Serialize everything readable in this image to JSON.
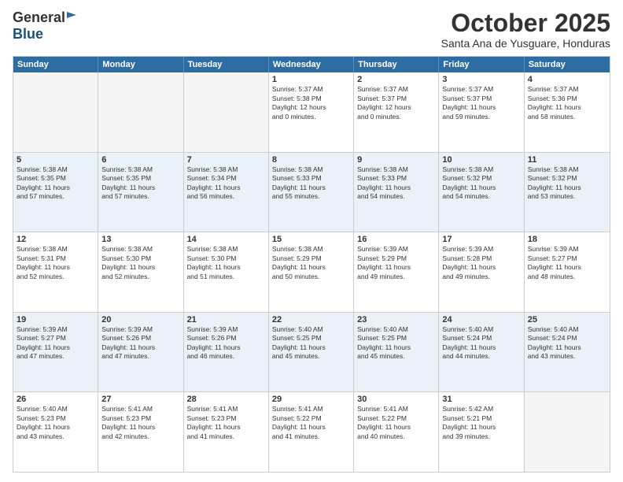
{
  "header": {
    "logo_general": "General",
    "logo_blue": "Blue",
    "month": "October 2025",
    "location": "Santa Ana de Yusguare, Honduras"
  },
  "weekdays": [
    "Sunday",
    "Monday",
    "Tuesday",
    "Wednesday",
    "Thursday",
    "Friday",
    "Saturday"
  ],
  "rows": [
    [
      {
        "day": "",
        "text": ""
      },
      {
        "day": "",
        "text": ""
      },
      {
        "day": "",
        "text": ""
      },
      {
        "day": "1",
        "text": "Sunrise: 5:37 AM\nSunset: 5:38 PM\nDaylight: 12 hours\nand 0 minutes."
      },
      {
        "day": "2",
        "text": "Sunrise: 5:37 AM\nSunset: 5:37 PM\nDaylight: 12 hours\nand 0 minutes."
      },
      {
        "day": "3",
        "text": "Sunrise: 5:37 AM\nSunset: 5:37 PM\nDaylight: 11 hours\nand 59 minutes."
      },
      {
        "day": "4",
        "text": "Sunrise: 5:37 AM\nSunset: 5:36 PM\nDaylight: 11 hours\nand 58 minutes."
      }
    ],
    [
      {
        "day": "5",
        "text": "Sunrise: 5:38 AM\nSunset: 5:35 PM\nDaylight: 11 hours\nand 57 minutes."
      },
      {
        "day": "6",
        "text": "Sunrise: 5:38 AM\nSunset: 5:35 PM\nDaylight: 11 hours\nand 57 minutes."
      },
      {
        "day": "7",
        "text": "Sunrise: 5:38 AM\nSunset: 5:34 PM\nDaylight: 11 hours\nand 56 minutes."
      },
      {
        "day": "8",
        "text": "Sunrise: 5:38 AM\nSunset: 5:33 PM\nDaylight: 11 hours\nand 55 minutes."
      },
      {
        "day": "9",
        "text": "Sunrise: 5:38 AM\nSunset: 5:33 PM\nDaylight: 11 hours\nand 54 minutes."
      },
      {
        "day": "10",
        "text": "Sunrise: 5:38 AM\nSunset: 5:32 PM\nDaylight: 11 hours\nand 54 minutes."
      },
      {
        "day": "11",
        "text": "Sunrise: 5:38 AM\nSunset: 5:32 PM\nDaylight: 11 hours\nand 53 minutes."
      }
    ],
    [
      {
        "day": "12",
        "text": "Sunrise: 5:38 AM\nSunset: 5:31 PM\nDaylight: 11 hours\nand 52 minutes."
      },
      {
        "day": "13",
        "text": "Sunrise: 5:38 AM\nSunset: 5:30 PM\nDaylight: 11 hours\nand 52 minutes."
      },
      {
        "day": "14",
        "text": "Sunrise: 5:38 AM\nSunset: 5:30 PM\nDaylight: 11 hours\nand 51 minutes."
      },
      {
        "day": "15",
        "text": "Sunrise: 5:38 AM\nSunset: 5:29 PM\nDaylight: 11 hours\nand 50 minutes."
      },
      {
        "day": "16",
        "text": "Sunrise: 5:39 AM\nSunset: 5:29 PM\nDaylight: 11 hours\nand 49 minutes."
      },
      {
        "day": "17",
        "text": "Sunrise: 5:39 AM\nSunset: 5:28 PM\nDaylight: 11 hours\nand 49 minutes."
      },
      {
        "day": "18",
        "text": "Sunrise: 5:39 AM\nSunset: 5:27 PM\nDaylight: 11 hours\nand 48 minutes."
      }
    ],
    [
      {
        "day": "19",
        "text": "Sunrise: 5:39 AM\nSunset: 5:27 PM\nDaylight: 11 hours\nand 47 minutes."
      },
      {
        "day": "20",
        "text": "Sunrise: 5:39 AM\nSunset: 5:26 PM\nDaylight: 11 hours\nand 47 minutes."
      },
      {
        "day": "21",
        "text": "Sunrise: 5:39 AM\nSunset: 5:26 PM\nDaylight: 11 hours\nand 46 minutes."
      },
      {
        "day": "22",
        "text": "Sunrise: 5:40 AM\nSunset: 5:25 PM\nDaylight: 11 hours\nand 45 minutes."
      },
      {
        "day": "23",
        "text": "Sunrise: 5:40 AM\nSunset: 5:25 PM\nDaylight: 11 hours\nand 45 minutes."
      },
      {
        "day": "24",
        "text": "Sunrise: 5:40 AM\nSunset: 5:24 PM\nDaylight: 11 hours\nand 44 minutes."
      },
      {
        "day": "25",
        "text": "Sunrise: 5:40 AM\nSunset: 5:24 PM\nDaylight: 11 hours\nand 43 minutes."
      }
    ],
    [
      {
        "day": "26",
        "text": "Sunrise: 5:40 AM\nSunset: 5:23 PM\nDaylight: 11 hours\nand 43 minutes."
      },
      {
        "day": "27",
        "text": "Sunrise: 5:41 AM\nSunset: 5:23 PM\nDaylight: 11 hours\nand 42 minutes."
      },
      {
        "day": "28",
        "text": "Sunrise: 5:41 AM\nSunset: 5:23 PM\nDaylight: 11 hours\nand 41 minutes."
      },
      {
        "day": "29",
        "text": "Sunrise: 5:41 AM\nSunset: 5:22 PM\nDaylight: 11 hours\nand 41 minutes."
      },
      {
        "day": "30",
        "text": "Sunrise: 5:41 AM\nSunset: 5:22 PM\nDaylight: 11 hours\nand 40 minutes."
      },
      {
        "day": "31",
        "text": "Sunrise: 5:42 AM\nSunset: 5:21 PM\nDaylight: 11 hours\nand 39 minutes."
      },
      {
        "day": "",
        "text": ""
      }
    ]
  ]
}
